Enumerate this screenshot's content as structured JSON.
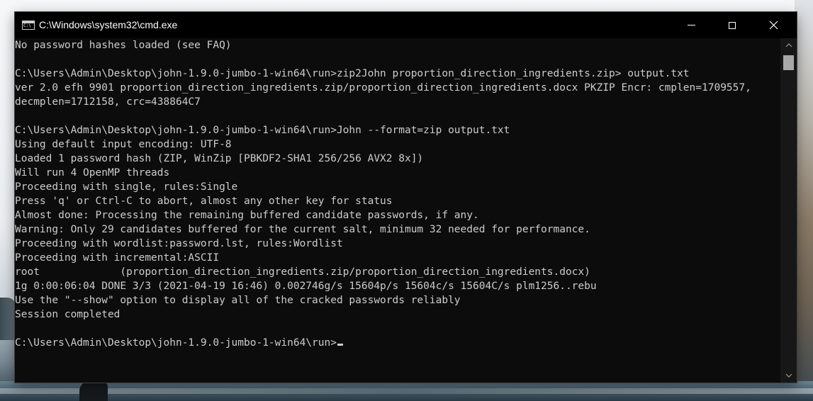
{
  "window": {
    "title": "C:\\Windows\\system32\\cmd.exe",
    "icon": "cmd-console-icon"
  },
  "console": {
    "lines": [
      "No password hashes loaded (see FAQ)",
      "",
      "C:\\Users\\Admin\\Desktop\\john-1.9.0-jumbo-1-win64\\run>zip2John proportion_direction_ingredients.zip> output.txt",
      "ver 2.0 efh 9901 proportion_direction_ingredients.zip/proportion_direction_ingredients.docx PKZIP Encr: cmplen=1709557,",
      "decmplen=1712158, crc=438864C7",
      "",
      "C:\\Users\\Admin\\Desktop\\john-1.9.0-jumbo-1-win64\\run>John --format=zip output.txt",
      "Using default input encoding: UTF-8",
      "Loaded 1 password hash (ZIP, WinZip [PBKDF2-SHA1 256/256 AVX2 8x])",
      "Will run 4 OpenMP threads",
      "Proceeding with single, rules:Single",
      "Press 'q' or Ctrl-C to abort, almost any other key for status",
      "Almost done: Processing the remaining buffered candidate passwords, if any.",
      "Warning: Only 29 candidates buffered for the current salt, minimum 32 needed for performance.",
      "Proceeding with wordlist:password.lst, rules:Wordlist",
      "Proceeding with incremental:ASCII",
      "root             (proportion_direction_ingredients.zip/proportion_direction_ingredients.docx)",
      "1g 0:00:06:04 DONE 3/3 (2021-04-19 16:46) 0.002746g/s 15604p/s 15604c/s 15604C/s plm1256..rebu",
      "Use the \"--show\" option to display all of the cracked passwords reliably",
      "Session completed",
      "",
      "C:\\Users\\Admin\\Desktop\\john-1.9.0-jumbo-1-win64\\run>"
    ]
  },
  "colors": {
    "console_bg": "#0c0c0c",
    "console_text": "#cccccc",
    "titlebar_bg": "#000000",
    "titlebar_text": "#ffffff"
  }
}
